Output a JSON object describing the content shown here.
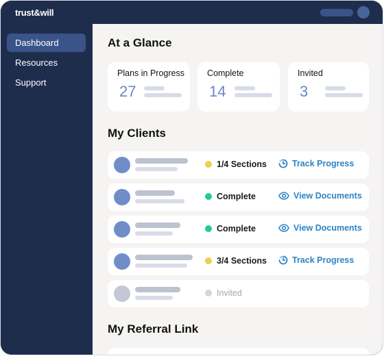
{
  "app": {
    "logo_text": "trust&will"
  },
  "sidebar": {
    "items": [
      {
        "label": "Dashboard",
        "active": true
      },
      {
        "label": "Resources",
        "active": false
      },
      {
        "label": "Support",
        "active": false
      }
    ]
  },
  "at_a_glance": {
    "title": "At a Glance",
    "cards": [
      {
        "label": "Plans in Progress",
        "value": "27"
      },
      {
        "label": "Complete",
        "value": "14"
      },
      {
        "label": "Invited",
        "value": "3"
      }
    ]
  },
  "my_clients": {
    "title": "My Clients",
    "rows": [
      {
        "status": "1/4 Sections",
        "status_color": "#ecd04f",
        "action": "Track Progress",
        "action_icon": "progress-clock-icon"
      },
      {
        "status": "Complete",
        "status_color": "#1fcd8f",
        "action": "View Documents",
        "action_icon": "eye-icon"
      },
      {
        "status": "Complete",
        "status_color": "#1fcd8f",
        "action": "View Documents",
        "action_icon": "eye-icon"
      },
      {
        "status": "3/4 Sections",
        "status_color": "#ecd04f",
        "action": "Track Progress",
        "action_icon": "progress-clock-icon"
      },
      {
        "status": "Invited",
        "status_color": "#d6d6d9",
        "action": null,
        "action_icon": null
      }
    ]
  },
  "referral": {
    "title": "My Referral Link"
  },
  "colors": {
    "navy": "#1f2d4d",
    "accent_blue": "#3a5388",
    "link_blue": "#2d83c6",
    "stat_blue": "#6a87c2"
  }
}
